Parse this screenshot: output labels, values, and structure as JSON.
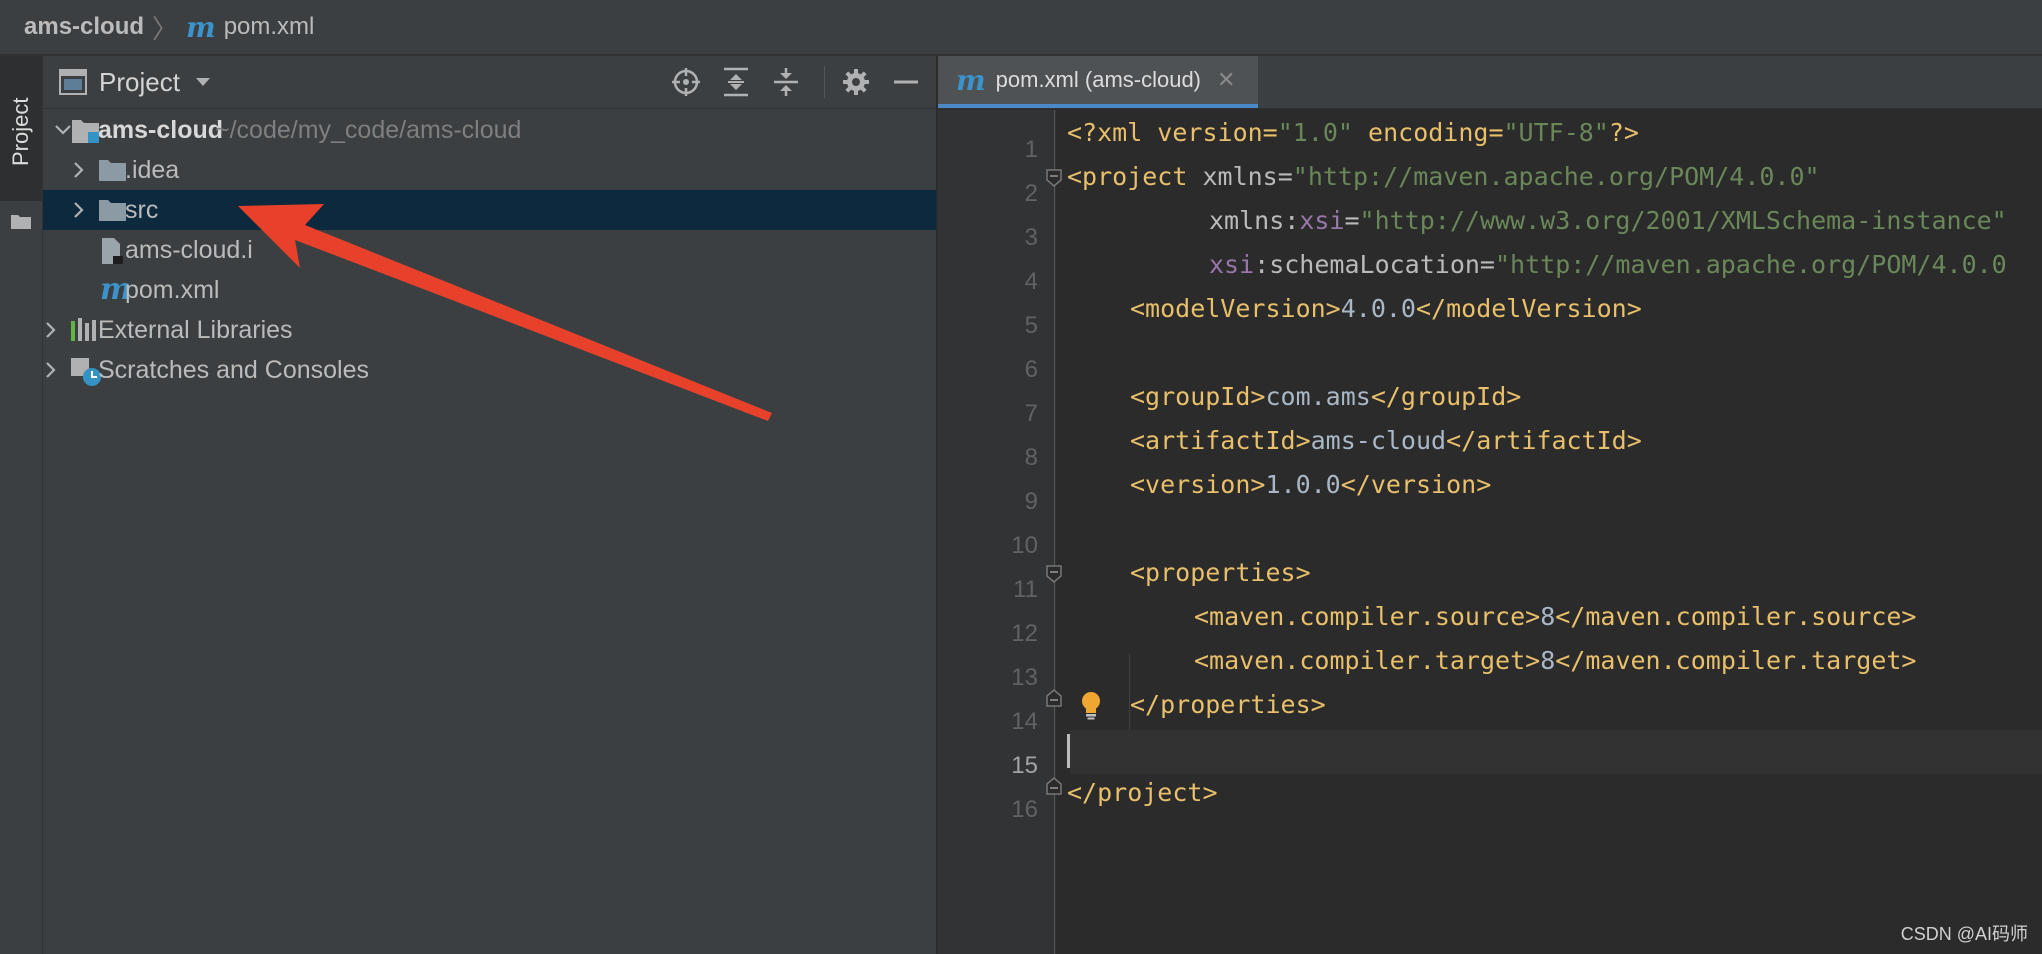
{
  "navbar": {
    "project": "ams-cloud",
    "file": "pom.xml",
    "separator": "〉"
  },
  "tool_stripe": {
    "label": "Project"
  },
  "project_panel": {
    "title": "Project",
    "tree": {
      "root": {
        "name": "ams-cloud",
        "path": "~/code/my_code/ams-cloud"
      },
      "idea": ".idea",
      "src": "src",
      "iml": "ams-cloud.i",
      "pom": "pom.xml",
      "external": "External Libraries",
      "scratches": "Scratches and Consoles"
    }
  },
  "editor": {
    "tab_label": "pom.xml (ams-cloud)",
    "current_line": 15,
    "line_numbers": [
      "1",
      "2",
      "3",
      "4",
      "5",
      "6",
      "7",
      "8",
      "9",
      "10",
      "11",
      "12",
      "13",
      "14",
      "15",
      "16"
    ],
    "code": {
      "l1": [
        "<?xml version=",
        "\"1.0\"",
        " encoding=",
        "\"UTF-8\"",
        "?>"
      ],
      "l2": [
        "<project ",
        "xmlns=",
        "\"http://maven.apache.org/POM/4.0.0\""
      ],
      "l3": [
        "xmlns:",
        "xsi",
        "=",
        "\"http://www.w3.org/2001/XMLSchema-instance\""
      ],
      "l4": [
        "xsi",
        ":schemaLocation=",
        "\"http://maven.apache.org/POM/4.0.0"
      ],
      "l5": [
        "<modelVersion>",
        "4.0.0",
        "</modelVersion>"
      ],
      "l7": [
        "<groupId>",
        "com.ams",
        "</groupId>"
      ],
      "l8": [
        "<artifactId>",
        "ams-cloud",
        "</artifactId>"
      ],
      "l9": [
        "<version>",
        "1.0.0",
        "</version>"
      ],
      "l11": [
        "<properties>"
      ],
      "l12": [
        "<maven.compiler.source>",
        "8",
        "</maven.compiler.source>"
      ],
      "l13": [
        "<maven.compiler.target>",
        "8",
        "</maven.compiler.target>"
      ],
      "l14": [
        "</properties>"
      ],
      "l16": [
        "</project>"
      ]
    }
  },
  "watermark": "CSDN @AI码师",
  "colors": {
    "background": "#2b2b2b",
    "panel": "#3c3f41",
    "selection": "#0d293e",
    "tag": "#e8bf6a",
    "string": "#6a8759",
    "namespace": "#9876aa",
    "annotation_arrow": "#e8412b",
    "maven_icon": "#3b93c9"
  },
  "icons": [
    "locate-icon",
    "expand-all-icon",
    "collapse-all-icon",
    "gear-icon",
    "minimize-icon",
    "folder-icon",
    "module-icon",
    "iml-file-icon",
    "maven-icon",
    "libraries-icon",
    "scratches-icon",
    "lightbulb-icon",
    "close-icon",
    "chevron-right-icon",
    "chevron-down-icon"
  ]
}
